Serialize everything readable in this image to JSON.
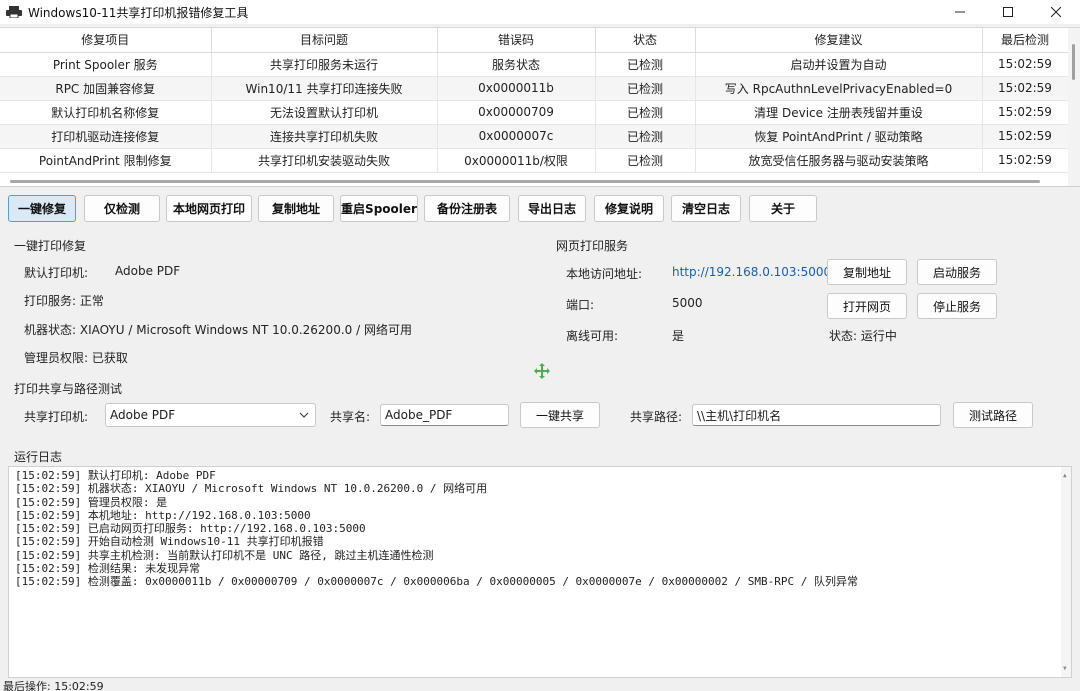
{
  "window": {
    "title": "Windows10-11共享打印机报错修复工具"
  },
  "table": {
    "headers": [
      "修复项目",
      "目标问题",
      "错误码",
      "状态",
      "修复建议",
      "最后检测"
    ],
    "rows": [
      [
        "Print Spooler 服务",
        "共享打印服务未运行",
        "服务状态",
        "已检测",
        "启动并设置为自动",
        "15:02:59"
      ],
      [
        "RPC 加固兼容修复",
        "Win10/11 共享打印连接失败",
        "0x0000011b",
        "已检测",
        "写入 RpcAuthnLevelPrivacyEnabled=0",
        "15:02:59"
      ],
      [
        "默认打印机名称修复",
        "无法设置默认打印机",
        "0x00000709",
        "已检测",
        "清理 Device 注册表残留并重设",
        "15:02:59"
      ],
      [
        "打印机驱动连接修复",
        "连接共享打印机失败",
        "0x0000007c",
        "已检测",
        "恢复 PointAndPrint / 驱动策略",
        "15:02:59"
      ],
      [
        "PointAndPrint 限制修复",
        "共享打印机安装驱动失败",
        "0x0000011b/权限",
        "已检测",
        "放宽受信任服务器与驱动安装策略",
        "15:02:59"
      ]
    ]
  },
  "toolbar": {
    "buttons": [
      "一键修复",
      "仅检测",
      "本地网页打印",
      "复制地址",
      "重启Spooler",
      "备份注册表",
      "导出日志",
      "修复说明",
      "清空日志",
      "关于"
    ]
  },
  "repair_group": {
    "title": "一键打印修复",
    "default_printer_label": "默认打印机:",
    "default_printer_value": "Adobe PDF",
    "print_service": "打印服务: 正常",
    "machine_status": "机器状态: XIAOYU / Microsoft Windows NT 10.0.26200.0 / 网络可用",
    "admin": "管理员权限: 已获取"
  },
  "web_group": {
    "title": "网页打印服务",
    "url_label": "本地访问地址:",
    "url_value": "http://192.168.0.103:5000",
    "port_label": "端口:",
    "port_value": "5000",
    "offline_label": "离线可用:",
    "offline_value": "是",
    "copy_btn": "复制地址",
    "start_btn": "启动服务",
    "open_btn": "打开网页",
    "stop_btn": "停止服务",
    "state": "状态: 运行中"
  },
  "share_group": {
    "title": "打印共享与路径测试",
    "printer_label": "共享打印机:",
    "printer_value": "Adobe PDF",
    "name_label": "共享名:",
    "name_value": "Adobe_PDF",
    "share_btn": "一键共享",
    "path_label": "共享路径:",
    "path_value": "\\\\主机\\打印机名",
    "test_btn": "测试路径"
  },
  "log": {
    "title": "运行日志",
    "lines": [
      "[15:02:59] 默认打印机: Adobe PDF",
      "[15:02:59] 机器状态: XIAOYU / Microsoft Windows NT 10.0.26200.0 / 网络可用",
      "[15:02:59] 管理员权限: 是",
      "[15:02:59] 本机地址: http://192.168.0.103:5000",
      "[15:02:59] 已启动网页打印服务: http://192.168.0.103:5000",
      "[15:02:59] 开始自动检测 Windows10-11 共享打印机报错",
      "[15:02:59] 共享主机检测: 当前默认打印机不是 UNC 路径, 跳过主机连通性检测",
      "[15:02:59] 检测结果: 未发现异常",
      "[15:02:59] 检测覆盖: 0x0000011b / 0x00000709 / 0x0000007c / 0x000006ba / 0x00000005 / 0x0000007e / 0x00000002 / SMB-RPC / 队列异常"
    ]
  },
  "status": {
    "text": "最后操作: 15:02:59"
  },
  "colors": {
    "primary_button_bg": "#dbe8f6",
    "primary_button_border": "#5c9ad6",
    "link": "#1a5fb4",
    "cursor": "#4caf50"
  }
}
